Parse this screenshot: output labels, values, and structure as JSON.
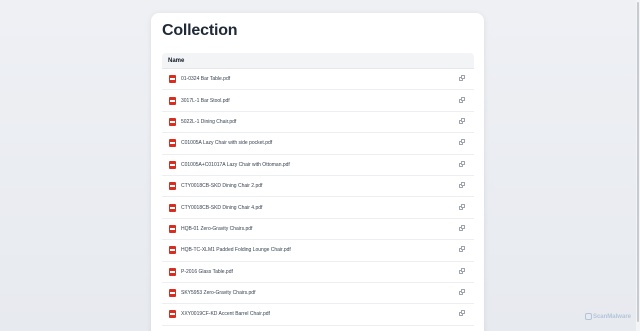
{
  "page": {
    "title": "Collection"
  },
  "table": {
    "header": "Name",
    "files": [
      "01-0324 Bar Table.pdf",
      "3017L-1 Bar Stool.pdf",
      "5022L-1 Dining Chair.pdf",
      "C01005A Lazy Chair with side pocket.pdf",
      "C01005A+C01017A Lazy Chair with Ottoman.pdf",
      "CTY0018CB-SKD Dining Chair 2.pdf",
      "CTY0018CB-SKD Dining Chair 4.pdf",
      "HQB-01 Zero-Gravity Chairs.pdf",
      "HQB-TC-XLM1 Padded Folding Lounge Chair.pdf",
      "P-2016 Glass Table.pdf",
      "SKY5953 Zero-Gravity Chairs.pdf",
      "XXY0019CF-KD Accent Barrel Chair.pdf"
    ]
  },
  "icons": {
    "file": "pdf-file-icon",
    "action": "copy-icon"
  },
  "watermark": {
    "text": "ScanMalware"
  },
  "colors": {
    "pdf": "#d92d20",
    "title": "#1f2937",
    "header_bg": "#f3f4f6"
  }
}
